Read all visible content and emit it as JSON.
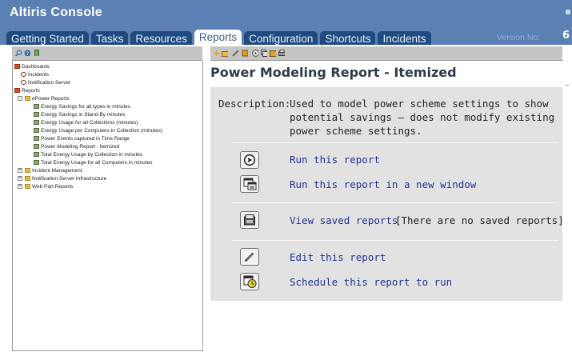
{
  "app": {
    "title": "Altiris Console",
    "version_label": "Version No:",
    "version_number": "6"
  },
  "tabs": [
    {
      "label": "Getting Started",
      "active": false
    },
    {
      "label": "Tasks",
      "active": false
    },
    {
      "label": "Resources",
      "active": false
    },
    {
      "label": "Reports",
      "active": true
    },
    {
      "label": "Configuration",
      "active": false
    },
    {
      "label": "Shortcuts",
      "active": false
    },
    {
      "label": "Incidents",
      "active": false
    }
  ],
  "left_toolbar": {
    "icons": [
      "search-icon",
      "help-icon",
      "refresh-icon"
    ]
  },
  "tree": [
    {
      "label": "Dashboards",
      "icon": "folder-red-icon"
    },
    {
      "label": "Incidents",
      "icon": "dashboard-icon"
    },
    {
      "label": "Notification Server",
      "icon": "dashboard-icon"
    },
    {
      "label": "Reports",
      "icon": "folder-red-icon"
    },
    {
      "label": "ePower Reports",
      "icon": "folder-icon"
    },
    {
      "label": "Energy Savings for all types in minutes",
      "icon": "report-icon"
    },
    {
      "label": "Energy Savings in Stand-By minutes",
      "icon": "report-icon"
    },
    {
      "label": "Energy Usage for all Collections (minutes)",
      "icon": "report-icon"
    },
    {
      "label": "Energy Usage per Computers in Collection (minutes)",
      "icon": "report-icon"
    },
    {
      "label": "Power Events captured in Time Range",
      "icon": "report-icon"
    },
    {
      "label": "Power Modeling Report - Itemized",
      "icon": "report-icon",
      "selected": true
    },
    {
      "label": "Total Energy Usage by Collection in minutes",
      "icon": "report-icon"
    },
    {
      "label": "Total Energy Usage for all Computers in minutes",
      "icon": "report-icon"
    },
    {
      "label": "Incident Management",
      "icon": "folder-icon"
    },
    {
      "label": "Notification Server Infrastructure",
      "icon": "folder-icon"
    },
    {
      "label": "Web Part Reports",
      "icon": "folder-icon"
    }
  ],
  "right_toolbar": {
    "icons": [
      "new-icon",
      "open-icon",
      "edit-icon",
      "save-icon",
      "run-icon",
      "clone-icon",
      "export-icon",
      "print-icon"
    ]
  },
  "report": {
    "title": "Power Modeling Report - Itemized",
    "description_label": "Description:",
    "description": "Used to model power scheme settings to show potential savings – does not modify existing power scheme settings.",
    "actions": {
      "run": "Run this report",
      "run_new_window": "Run this report in a new window",
      "view_saved": "View saved reports",
      "saved_note": "[There are no saved reports]",
      "edit": "Edit this report",
      "schedule": "Schedule this report to run"
    }
  },
  "colors": {
    "header": "#5b81b4",
    "tab": "#1f4b80",
    "link": "#23338f",
    "panel": "#e2e2e2"
  }
}
